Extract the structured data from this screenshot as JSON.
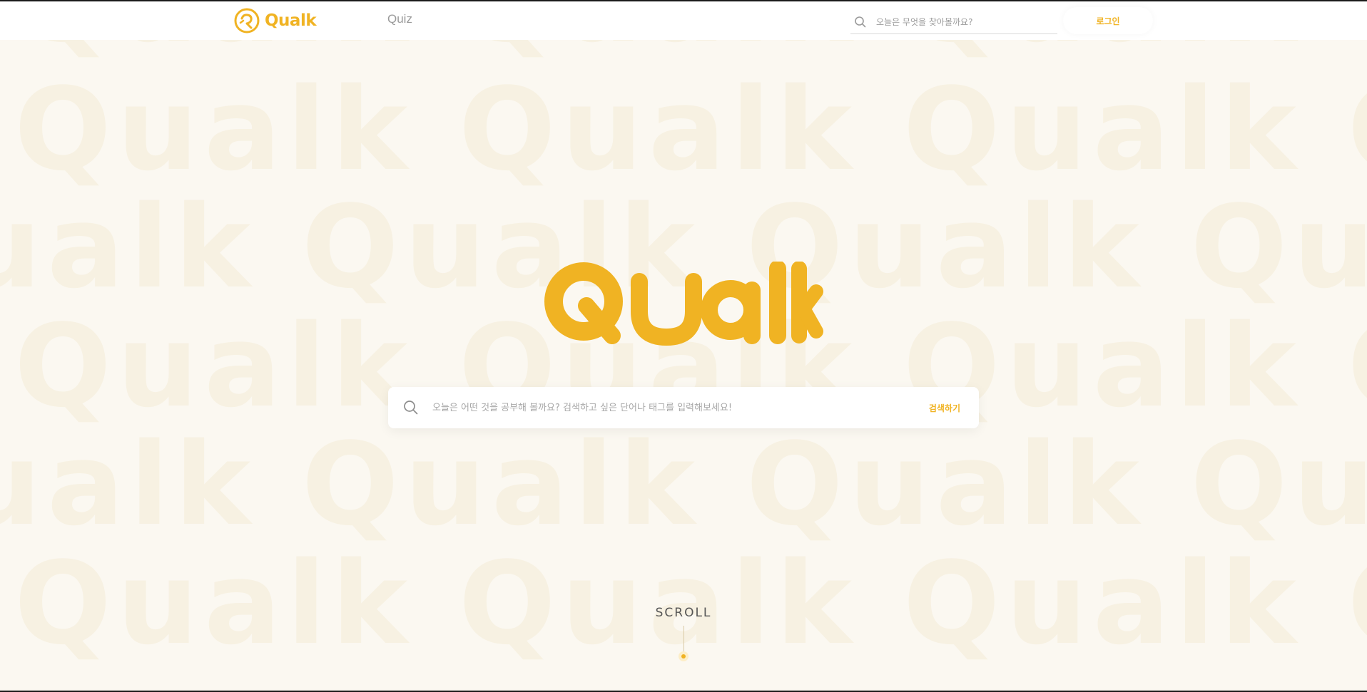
{
  "brand": {
    "name": "Qualk",
    "color": "#f0b323"
  },
  "header": {
    "nav": [
      {
        "label": "Quiz"
      }
    ],
    "search": {
      "placeholder": "오늘은 무엇을 찾아볼까요?",
      "icon": "search-icon"
    },
    "login_label": "로그인"
  },
  "hero": {
    "logo_text": "Qualk",
    "search": {
      "placeholder": "오늘은 어떤 것을 공부해 볼까요? 검색하고 싶은 단어나 태그를 입력해보세요!",
      "button_label": "검색하기",
      "icon": "search-icon"
    }
  },
  "scroll": {
    "label": "SCROLL"
  },
  "colors": {
    "background": "#fbf8f1",
    "watermark": "#f7f1e2",
    "accent": "#f0b323"
  }
}
